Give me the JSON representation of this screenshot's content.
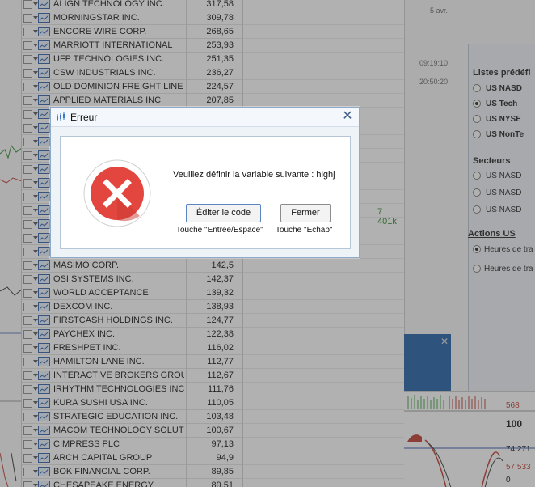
{
  "stocks": [
    {
      "name": "ALIGN TECHNOLOGY INC.",
      "price": "317,58"
    },
    {
      "name": "MORNINGSTAR INC.",
      "price": "309,78"
    },
    {
      "name": "ENCORE WIRE CORP.",
      "price": "268,65"
    },
    {
      "name": "MARRIOTT INTERNATIONAL",
      "price": "253,93"
    },
    {
      "name": "UFP TECHNOLOGIES INC.",
      "price": "251,35"
    },
    {
      "name": "CSW INDUSTRIALS INC.",
      "price": "236,27"
    },
    {
      "name": "OLD DOMINION FREIGHT LINE I...",
      "price": "224,57"
    },
    {
      "name": "APPLIED MATERIALS INC.",
      "price": "207,85"
    },
    {
      "name": "",
      "price": ""
    },
    {
      "name": "",
      "price": ""
    },
    {
      "name": "",
      "price": ""
    },
    {
      "name": "",
      "price": ""
    },
    {
      "name": "",
      "price": ""
    },
    {
      "name": "",
      "price": ""
    },
    {
      "name": "",
      "price": ""
    },
    {
      "name": "",
      "price": ""
    },
    {
      "name": "",
      "price": ""
    },
    {
      "name": "",
      "price": ""
    },
    {
      "name": "",
      "price": ""
    },
    {
      "name": "MASIMO CORP.",
      "price": "142,5"
    },
    {
      "name": "OSI SYSTEMS INC.",
      "price": "142,37"
    },
    {
      "name": "WORLD ACCEPTANCE",
      "price": "139,32"
    },
    {
      "name": "DEXCOM INC.",
      "price": "138,93"
    },
    {
      "name": "FIRSTCASH HOLDINGS INC.",
      "price": "124,77"
    },
    {
      "name": "PAYCHEX INC.",
      "price": "122,38"
    },
    {
      "name": "FRESHPET INC.",
      "price": "116,02"
    },
    {
      "name": "HAMILTON LANE INC.",
      "price": "112,77"
    },
    {
      "name": "INTERACTIVE BROKERS GROU...",
      "price": "112,67"
    },
    {
      "name": "IRHYTHM TECHNOLOGIES INC.",
      "price": "111,76"
    },
    {
      "name": "KURA SUSHI USA INC.",
      "price": "110,05"
    },
    {
      "name": "STRATEGIC EDUCATION INC.",
      "price": "103,48"
    },
    {
      "name": "MACOM TECHNOLOGY SOLUTI...",
      "price": "100,67"
    },
    {
      "name": "CIMPRESS PLC",
      "price": "97,13"
    },
    {
      "name": "ARCH CAPITAL GROUP",
      "price": "94,9"
    },
    {
      "name": "BOK FINANCIAL CORP.",
      "price": "89,85"
    },
    {
      "name": "CHESAPEAKE ENERGY",
      "price": "89,51"
    }
  ],
  "mid": {
    "volume_text": "7 401k"
  },
  "right": {
    "date_text": "5 avr.",
    "time_1": "09:19:10",
    "time_2": "20:50:20",
    "presets_title": "Listes prédéfi",
    "presets": [
      {
        "label": "US NASD",
        "selected": false
      },
      {
        "label": "US Tech",
        "selected": true
      },
      {
        "label": "US NYSE",
        "selected": false
      },
      {
        "label": "US NonTe",
        "selected": false
      }
    ],
    "sectors_title": "Secteurs",
    "sectors": [
      {
        "label": "US NASD"
      },
      {
        "label": "US NASD"
      },
      {
        "label": "US NASD"
      }
    ],
    "actions_title": "Actions US",
    "hours": [
      {
        "label": "Heures de tra",
        "selected": true
      },
      {
        "label": "Heures de tra",
        "selected": false
      }
    ],
    "banner_close": "✕",
    "values": [
      "568",
      "100",
      "74,271",
      "57,533",
      "0"
    ]
  },
  "dialog": {
    "title": "Erreur",
    "close_glyph": "✕",
    "icon": "error-x-icon",
    "message": "Veuillez définir la variable suivante : highj",
    "edit_button": "Éditer le code",
    "close_button": "Fermer",
    "hint_enter": "Touche \"Entrée/Espace\"",
    "hint_escape": "Touche \"Echap\"",
    "colors": {
      "error_red": "#e2463e",
      "accent_blue": "#3f5f86"
    }
  }
}
